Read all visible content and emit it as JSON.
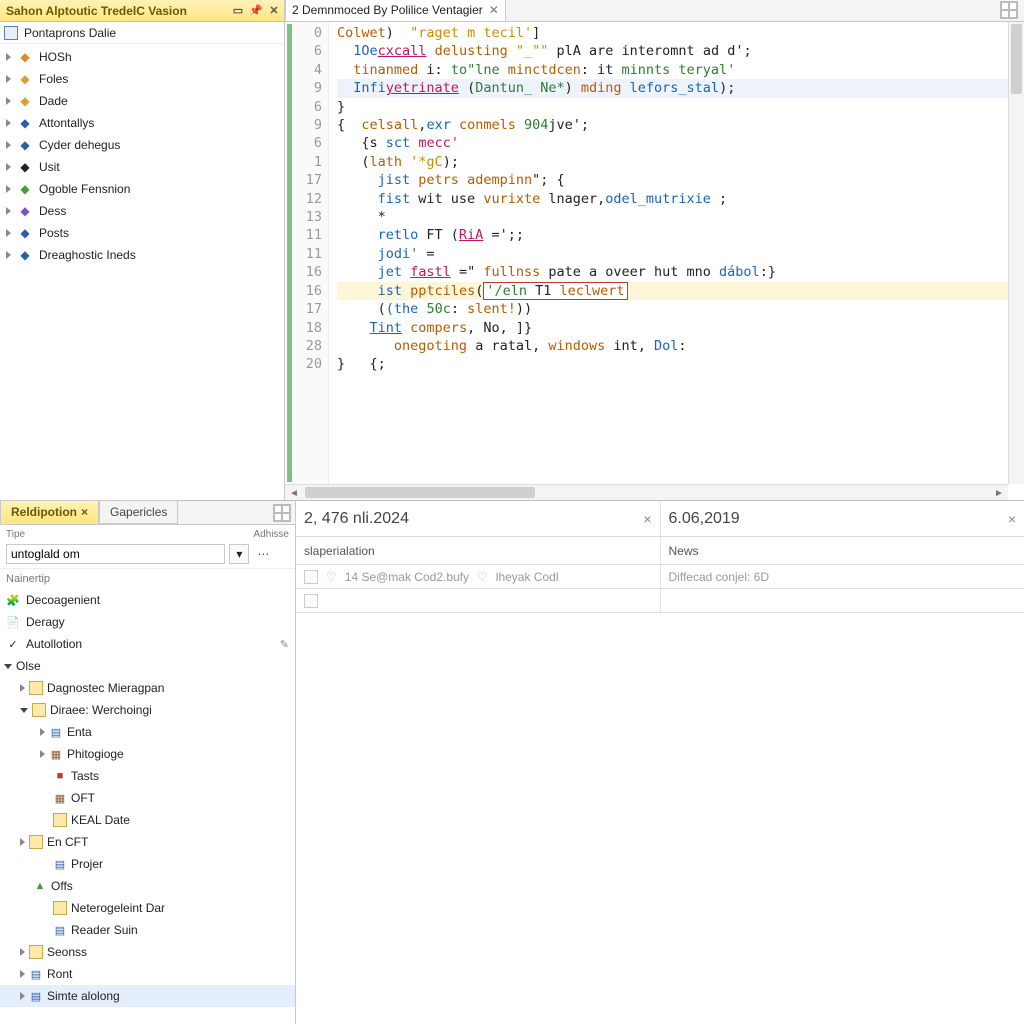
{
  "sidebar": {
    "title": "Sahon Alptoutic TredelC Vasion",
    "root_label": "Pontaprons Dalie",
    "items": [
      {
        "label": "HOSh",
        "icon": "orange"
      },
      {
        "label": "Foles",
        "icon": "folder"
      },
      {
        "label": "Dade",
        "icon": "folder"
      },
      {
        "label": "Attontallys",
        "icon": "dblue"
      },
      {
        "label": "Cyder dehegus",
        "icon": "dblue"
      },
      {
        "label": "Usit",
        "icon": "black"
      },
      {
        "label": "Ogoble Fensnion",
        "icon": "green"
      },
      {
        "label": "Dess",
        "icon": "purple"
      },
      {
        "label": "Posts",
        "icon": "dblue"
      },
      {
        "label": "Dreaghostic Ineds",
        "icon": "dblue"
      }
    ]
  },
  "editor": {
    "tab_label": "2 Demnmoced By Polilice Ventagier",
    "line_numbers": [
      "0",
      "6",
      "4",
      "9",
      "6",
      "9",
      "6",
      "1",
      "17",
      "12",
      "13",
      "11",
      "11",
      "16",
      "16",
      "17",
      "18",
      "28",
      "20"
    ],
    "code_html": [
      "<span class='k-call'>Colwet</span>)  <span class='k-str'>\"raget m tecil'</span>]",
      "  <span class='k-kw'>1Oe</span><span class='k-id k-under'>cxcall</span> <span class='k-call'>delusting</span> <span class='k-str'>\"_\"\"</span> plA are interomnt ad d';",
      "  <span class='k-call'>tinanmed</span> i: <span class='k-comm'>to\"lne</span> <span class='k-call'>minctdcen</span>: it <span class='k-comm'>minnts teryal'</span>",
      "  <span class='k-kw'>Infi</span><span class='k-id k-under'>yetrinate</span> (<span class='k-comm'>Dantun_&nbsp;Ne*</span>) <span class='k-call'>mding</span> <span class='k-kw'>lefors_stal</span>);",
      "}",
      "{  <span class='k-call'>celsall</span>,<span class='k-kw'>exr</span> <span class='k-call'>conmels</span> <span class='k-num'>904</span>jve';",
      "   {s <span class='k-kw'>sct</span> <span class='k-id'>mecc'</span>",
      "   (<span class='k-call'>lath</span> <span class='k-str'>'*gC</span>);",
      "     <span class='k-kw'>jist</span> <span class='k-call'>petrs</span> <span class='k-call'>adempinn</span>\"; {",
      "     <span class='k-kw'>fist</span> wit use <span class='k-call'>vurixte</span> lnager,<span class='k-kw'>odel_mutrixie</span> ;",
      "     *",
      "     <span class='k-kw'>retlo</span> FT (<span class='k-id k-under'>RiA</span> =';;",
      "     <span class='k-kw'>jodi'</span> =",
      "     <span class='k-kw'>jet</span> <span class='k-id k-under'>fastl</span> =\" <span class='k-call'>fullnss</span> pate a oveer hut mno <span class='k-kw'>dábol</span>:}",
      "     <span class='hl-line'><span class='k-kw'>ist</span> <span class='k-call'>pptciles</span>(<span class='err-box'><span class='k-comm'>'/eln</span> T1 <span class='k-call'>leclwert</span></span></span>",
      "     (<span class='k-kw'>(the</span> <span class='k-num'>50c</span>: <span class='k-call'>slent!</span>))",
      "    <span class='k-kw k-under'>Tint</span> <span class='k-call'>compers</span>, No, ]}",
      "       <span class='k-call'>onegoting</span> a ratal, <span class='k-call'>windows</span> int, <span class='k-kw'>Dol</span>:",
      "}   {;"
    ]
  },
  "bottom_left": {
    "tabs": {
      "active": "Reldipotion",
      "inactive": "Gapericles"
    },
    "form": {
      "label_left": "Tipe",
      "label_right": "Adhisse",
      "input_value": "untoglald om"
    },
    "section_label": "Nainertip",
    "cats": [
      {
        "label": "Decoagenient",
        "icon": "🧩"
      },
      {
        "label": "Deragy",
        "icon": "📄"
      },
      {
        "label": "Autollotion",
        "icon": "✓",
        "edit": true
      }
    ],
    "tree": [
      {
        "d": 0,
        "arrow": "d",
        "icon": "",
        "label": "Olse"
      },
      {
        "d": 1,
        "arrow": "r",
        "icon": "fld",
        "label": "Dagnostec Mieragpan"
      },
      {
        "d": 1,
        "arrow": "d",
        "icon": "fld",
        "label": "Diraee: Werchoingi"
      },
      {
        "d": 2,
        "arrow": "r",
        "icon": "file",
        "label": "Enta"
      },
      {
        "d": 2,
        "arrow": "r",
        "icon": "doc",
        "label": "Phitogioge"
      },
      {
        "d": 2,
        "arrow": "",
        "icon": "red",
        "label": "Tasts"
      },
      {
        "d": 2,
        "arrow": "",
        "icon": "doc",
        "label": "OFT"
      },
      {
        "d": 2,
        "arrow": "",
        "icon": "fld",
        "label": "KEAL Date"
      },
      {
        "d": 1,
        "arrow": "r",
        "icon": "fld",
        "label": "En CFT"
      },
      {
        "d": 2,
        "arrow": "",
        "icon": "file",
        "label": "Projer"
      },
      {
        "d": 1,
        "arrow": "",
        "icon": "warn",
        "label": "Offs"
      },
      {
        "d": 2,
        "arrow": "",
        "icon": "fld",
        "label": "Neterogeleint Dar"
      },
      {
        "d": 2,
        "arrow": "",
        "icon": "file",
        "label": "Reader Suin"
      },
      {
        "d": 1,
        "arrow": "r",
        "icon": "fld",
        "label": "Seonss"
      },
      {
        "d": 1,
        "arrow": "r",
        "icon": "file",
        "label": "Ront"
      },
      {
        "d": 1,
        "arrow": "r",
        "icon": "file",
        "label": "Simte alolong",
        "sel": true
      }
    ]
  },
  "compare": {
    "left": {
      "date": "2, 476 nli.2024",
      "subtitle": "slaperialation",
      "meta1": "14 Se@mak Cod2.bufy",
      "meta2": "lheyak Codl"
    },
    "right": {
      "date": "6.06,2019",
      "subtitle": "News",
      "meta": "Diffecad conjel: 6D"
    }
  }
}
